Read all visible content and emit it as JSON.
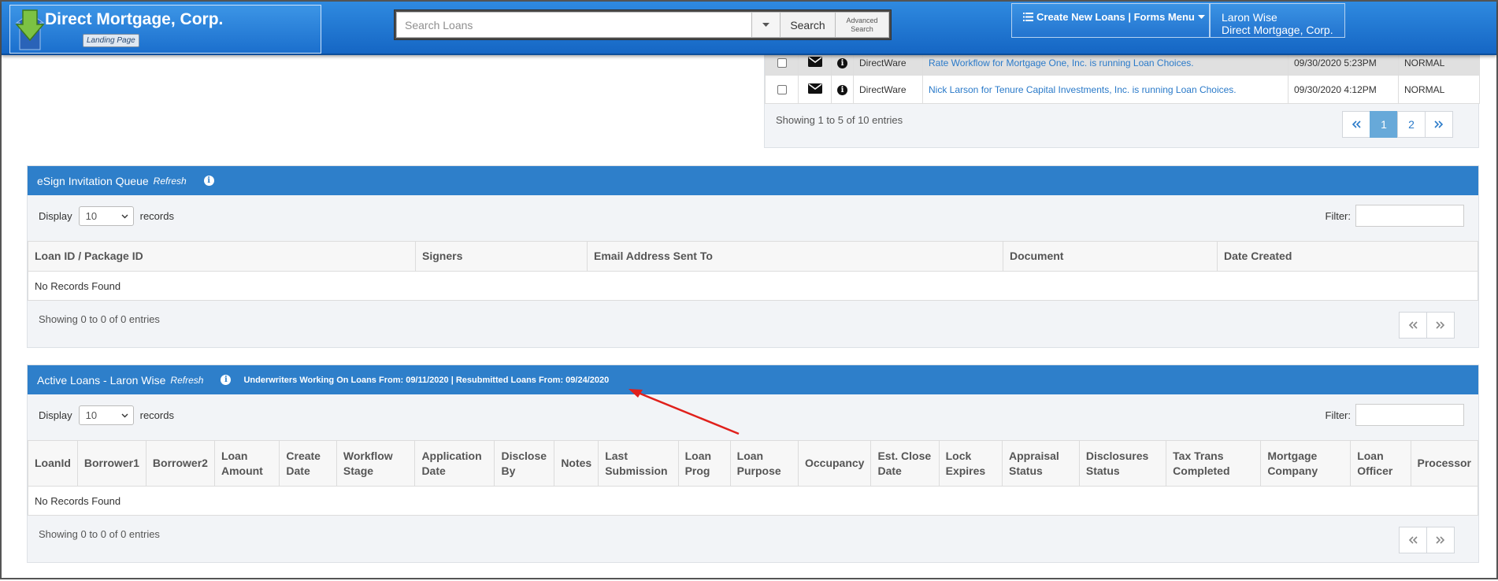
{
  "header": {
    "brand_name": "Direct Mortgage, Corp.",
    "landing_page": "Landing Page",
    "search_placeholder": "Search Loans",
    "search_button": "Search",
    "advanced_line1": "Advanced",
    "advanced_line2": "Search",
    "forms_menu": "Create New Loans | Forms Menu",
    "user_name": "Laron Wise",
    "user_company": "Direct Mortgage, Corp."
  },
  "notifications": {
    "rows": [
      {
        "source": "DirectWare",
        "message": "Rate Workflow for Mortgage One, Inc. is running Loan Choices.",
        "date": "09/30/2020 5:23PM",
        "priority": "NORMAL"
      },
      {
        "source": "DirectWare",
        "message": "Nick Larson for Tenure Capital Investments, Inc. is running Loan Choices.",
        "date": "09/30/2020 4:12PM",
        "priority": "NORMAL"
      }
    ],
    "showing": "Showing 1 to 5 of 10 entries",
    "pages": [
      "1",
      "2"
    ]
  },
  "esign": {
    "title": "eSign Invitation Queue",
    "refresh": "Refresh",
    "display_label": "Display",
    "display_value": "10",
    "records_label": "records",
    "filter_label": "Filter:",
    "columns": [
      "Loan ID / Package ID",
      "Signers",
      "Email Address Sent To",
      "Document",
      "Date Created"
    ],
    "empty": "No Records Found",
    "showing": "Showing 0 to 0 of 0 entries"
  },
  "active": {
    "title": "Active Loans - Laron Wise",
    "refresh": "Refresh",
    "underwriters_note": "Underwriters Working On Loans From: 09/11/2020 | Resubmitted Loans From: 09/24/2020",
    "display_label": "Display",
    "display_value": "10",
    "records_label": "records",
    "filter_label": "Filter:",
    "columns": [
      "LoanId",
      "Borrower1",
      "Borrower2",
      "Loan Amount",
      "Create Date",
      "Workflow Stage",
      "Application Date",
      "Disclose By",
      "Notes",
      "Last Submission",
      "Loan Prog",
      "Loan Purpose",
      "Occupancy",
      "Est. Close Date",
      "Lock Expires",
      "Appraisal Status",
      "Disclosures Status",
      "Tax Trans Completed",
      "Mortgage Company",
      "Loan Officer",
      "Processor"
    ],
    "empty": "No Records Found",
    "showing": "Showing 0 to 0 of 0 entries"
  },
  "colors": {
    "header_blue": "#1a6fcd",
    "section_blue": "#2e7fca",
    "link_blue": "#2a7ac9",
    "annotation_arrow": "#e0201b"
  }
}
